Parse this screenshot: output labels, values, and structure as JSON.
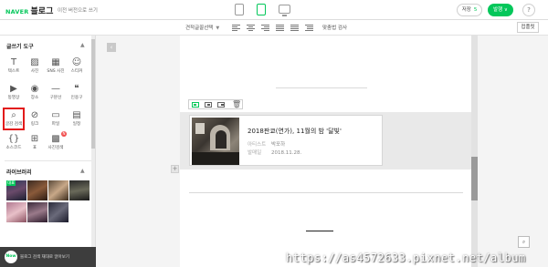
{
  "header": {
    "brand": "NAVER",
    "product": "블로그",
    "prev_version_link": "이전 버전으로 쓰기",
    "save_label": "저장",
    "save_count": "5",
    "publish_label": "발행 ∨",
    "help_label": "?"
  },
  "format_toolbar": {
    "font_select": "견적글꼴선택",
    "spell_check": "맞춤법 검사",
    "close_label": "접플릿"
  },
  "left_panel": {
    "tools_title": "글쓰기 도구",
    "tools": [
      {
        "icon": "text-icon",
        "glyph": "T",
        "label": "텍스트"
      },
      {
        "icon": "photo-icon",
        "glyph": "▨",
        "label": "사진"
      },
      {
        "icon": "sns-photo-icon",
        "glyph": "▦",
        "label": "SNS 사진"
      },
      {
        "icon": "sticker-icon",
        "glyph": "☺",
        "label": "스티커"
      },
      {
        "icon": "video-icon",
        "glyph": "▶",
        "label": "동영상"
      },
      {
        "icon": "place-icon",
        "glyph": "◉",
        "label": "장소"
      },
      {
        "icon": "divider-icon",
        "glyph": "—",
        "label": "구분선"
      },
      {
        "icon": "quote-icon",
        "glyph": "❝",
        "label": "인용구"
      },
      {
        "icon": "search-glass-icon",
        "glyph": "⌕",
        "label": "글감 검색"
      },
      {
        "icon": "link-icon",
        "glyph": "⊘",
        "label": "링크"
      },
      {
        "icon": "file-icon",
        "glyph": "▭",
        "label": "파일"
      },
      {
        "icon": "calendar-icon",
        "glyph": "▤",
        "label": "일정"
      },
      {
        "icon": "source-code-icon",
        "glyph": "{}",
        "label": "소스코드"
      },
      {
        "icon": "table-icon",
        "glyph": "⊞",
        "label": "표"
      },
      {
        "icon": "photo-search-icon",
        "glyph": "▩",
        "label": "사진검색",
        "badge": "N"
      }
    ],
    "library_title": "라이브러리",
    "library_tag": "대표",
    "banner_logo": "Now",
    "banner_text": "블로그 검색 재대로 알아보기"
  },
  "editor": {
    "music": {
      "title": "2018판쿄(연가), 11월의 밤 '달빛'",
      "artist_key": "아티스트",
      "artist": "박포하",
      "release_key": "발매일",
      "release_date": "2018.11.28."
    },
    "plus": "+"
  },
  "watermark": "https://as4572633.pixnet.net/album",
  "colors": {
    "brand_green": "#03c75a",
    "highlight_red": "#e21a1a"
  }
}
